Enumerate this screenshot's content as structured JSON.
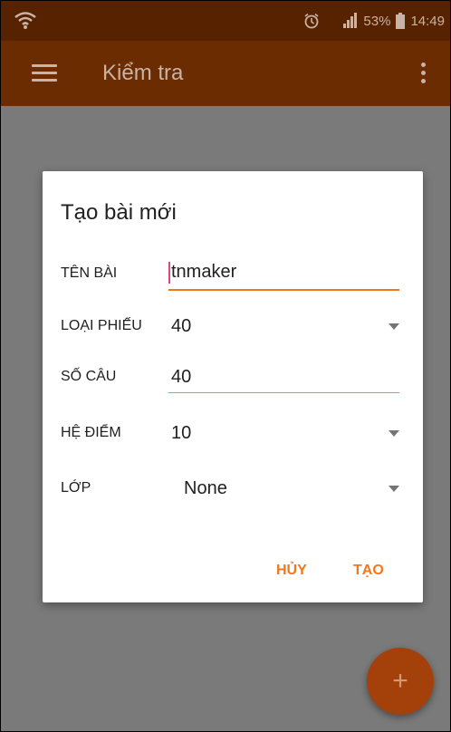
{
  "status_bar": {
    "battery_percent": "53%",
    "time": "14:49",
    "icons": [
      "wifi-icon",
      "alarm-icon",
      "signal-icon",
      "battery-icon"
    ]
  },
  "app_bar": {
    "title": "Kiểm tra",
    "icons": [
      "menu-icon",
      "more-vert-icon"
    ]
  },
  "dialog": {
    "title": "Tạo bài mới",
    "fields": {
      "name": {
        "label": "TÊN BÀI",
        "value": "tnmaker"
      },
      "sheet_type": {
        "label": "LOẠI PHIẾU",
        "value": "40"
      },
      "question_count": {
        "label": "SỐ CÂU",
        "value": "40"
      },
      "grade_scale": {
        "label": "HỆ ĐIỂM",
        "value": "10"
      },
      "class": {
        "label": "LỚP",
        "value": "None"
      }
    },
    "buttons": {
      "cancel": "HỦY",
      "create": "TẠO"
    }
  },
  "fab": {
    "label": "+",
    "icon": "add-icon"
  },
  "colors": {
    "status_bar": "#562200",
    "app_bar": "#6a2c00",
    "accent": "#f0781e",
    "fab": "#a4410b",
    "scrim": "#7a7a7a"
  }
}
